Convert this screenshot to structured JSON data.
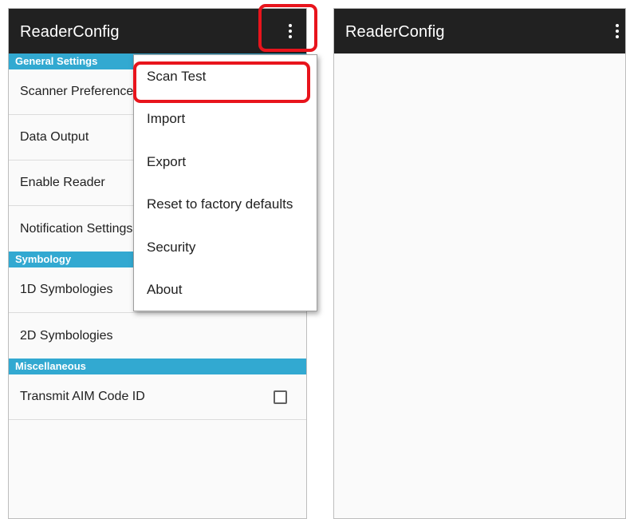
{
  "left": {
    "appbar": {
      "title": "ReaderConfig",
      "overflow_icon": "more-vert-icon"
    },
    "sections": [
      {
        "header": "General Settings"
      },
      {
        "header": "Symbology"
      },
      {
        "header": "Miscellaneous"
      }
    ],
    "general_items": [
      "Scanner Preferences",
      "Data Output",
      "Enable Reader",
      "Notification Settings"
    ],
    "symbology_items": [
      "1D Symbologies",
      "2D Symbologies"
    ],
    "misc_items": [
      {
        "label": "Transmit AIM Code ID",
        "checked": false
      }
    ]
  },
  "menu": {
    "items": [
      "Scan Test",
      "Import",
      "Export",
      "Reset to factory defaults",
      "Security",
      "About"
    ]
  },
  "right": {
    "appbar": {
      "title": "ReaderConfig",
      "overflow_icon": "more-vert-icon"
    }
  },
  "colors": {
    "appbar": "#212121",
    "section_header": "#32a9d1",
    "highlight": "#e8141c"
  }
}
